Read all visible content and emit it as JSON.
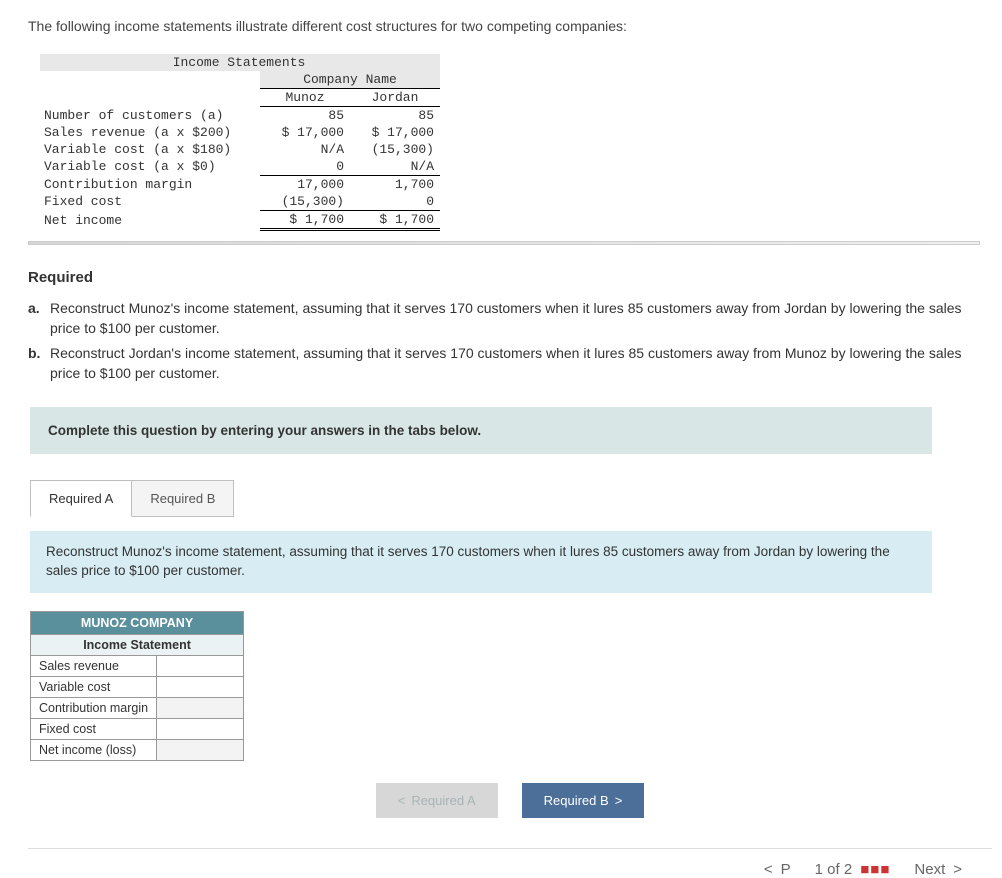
{
  "intro": "The following income statements illustrate different cost structures for two competing companies:",
  "income": {
    "title": "Income Statements",
    "company_header": "Company Name",
    "columns": [
      "Munoz",
      "Jordan"
    ],
    "rows": [
      {
        "label": "Number of customers (a)",
        "munoz": "85",
        "jordan": "85"
      },
      {
        "label": "Sales revenue (a x $200)",
        "munoz": "$ 17,000",
        "jordan": "$ 17,000"
      },
      {
        "label": "Variable cost (a x $180)",
        "munoz": "N/A",
        "jordan": "(15,300)"
      },
      {
        "label": "Variable cost (a x $0)",
        "munoz": "0",
        "jordan": "N/A"
      },
      {
        "label": "Contribution margin",
        "munoz": "17,000",
        "jordan": "1,700"
      },
      {
        "label": "Fixed cost",
        "munoz": "(15,300)",
        "jordan": "0"
      },
      {
        "label": "Net income",
        "munoz": "$  1,700",
        "jordan": "$  1,700"
      }
    ]
  },
  "required_heading": "Required",
  "requirements": {
    "a": {
      "letter": "a.",
      "text": "Reconstruct Munoz's income statement, assuming that it serves 170 customers when it lures 85 customers away from Jordan by lowering the sales price to $100 per customer."
    },
    "b": {
      "letter": "b.",
      "text": "Reconstruct Jordan's income statement, assuming that it serves 170 customers when it lures 85 customers away from Munoz by lowering the sales price to $100 per customer."
    }
  },
  "banner": "Complete this question by entering your answers in the tabs below.",
  "tabs": {
    "a": "Required A",
    "b": "Required B"
  },
  "tab_description": "Reconstruct Munoz's income statement, assuming that it serves 170 customers when it lures 85 customers away from Jordan by lowering the sales price to $100 per customer.",
  "answer": {
    "company": "MUNOZ COMPANY",
    "subtitle": "Income Statement",
    "rows": [
      "Sales revenue",
      "Variable cost",
      "Contribution margin",
      "Fixed cost",
      "Net income (loss)"
    ]
  },
  "nav": {
    "prev": "Required A",
    "next": "Required B"
  },
  "footer": {
    "left_letter": "P",
    "mid": "1 of 2",
    "next_label": "Next"
  },
  "chevrons": {
    "left": "<",
    "right": ">"
  }
}
